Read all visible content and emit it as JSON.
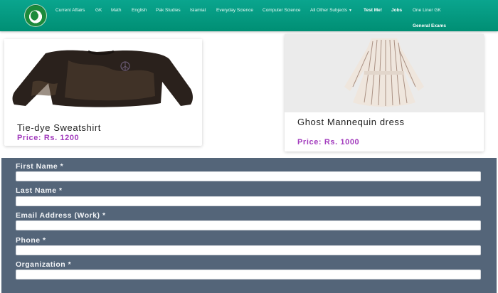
{
  "nav": {
    "items": [
      {
        "label": "Current Affairs",
        "bold": false
      },
      {
        "label": "GK",
        "bold": false
      },
      {
        "label": "Math",
        "bold": false
      },
      {
        "label": "English",
        "bold": false
      },
      {
        "label": "Pak Studies",
        "bold": false
      },
      {
        "label": "Islamiat",
        "bold": false
      },
      {
        "label": "Everyday Science",
        "bold": false
      },
      {
        "label": "Computer Science",
        "bold": false
      },
      {
        "label": "All Other Subjects",
        "bold": false,
        "dropdown": true
      },
      {
        "label": "Test Me!",
        "bold": true
      },
      {
        "label": "Jobs",
        "bold": true
      },
      {
        "label": "One Liner GK",
        "bold": false
      },
      {
        "label": "General Exams",
        "bold": true
      }
    ],
    "colors": {
      "top": "#0aa58e",
      "bottom": "#008f74"
    }
  },
  "products": [
    {
      "title": "Tie-dye Sweatshirt",
      "price": "Price: Rs. 1200",
      "image": "sweatshirt-image"
    },
    {
      "title": "Ghost Mannequin dress",
      "price": "Price: Rs. 1000",
      "image": "dress-image"
    }
  ],
  "form": {
    "fields": [
      {
        "label": "First Name *",
        "value": ""
      },
      {
        "label": "Last Name *",
        "value": ""
      },
      {
        "label": "Email Address (Work) *",
        "value": ""
      },
      {
        "label": "Phone *",
        "value": ""
      },
      {
        "label": "Organization *",
        "value": ""
      }
    ],
    "background_color": "#546579"
  },
  "colors": {
    "price": "#a23bbd"
  }
}
